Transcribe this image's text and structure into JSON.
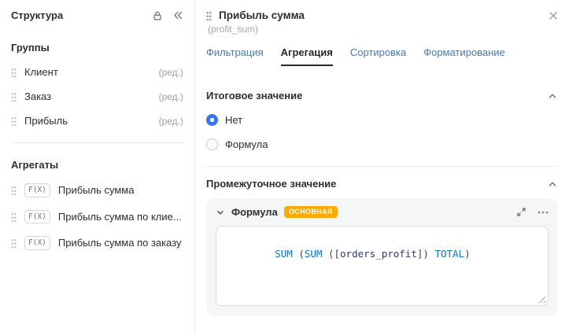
{
  "sidebar": {
    "title": "Структура",
    "groups_header": "Группы",
    "groups": [
      {
        "label": "Клиент",
        "edit": "(ред.)"
      },
      {
        "label": "Заказ",
        "edit": "(ред.)"
      },
      {
        "label": "Прибыль",
        "edit": "(ред.)"
      }
    ],
    "aggregates_header": "Агрегаты",
    "aggregates": [
      {
        "badge": "F(X)",
        "label": "Прибыль сумма"
      },
      {
        "badge": "F(X)",
        "label": "Прибыль сумма по клие..."
      },
      {
        "badge": "F(X)",
        "label": "Прибыль сумма по заказу"
      }
    ]
  },
  "panel": {
    "title": "Прибыль сумма",
    "subtitle": "(profit_sum)",
    "tabs": [
      {
        "label": "Фильтрация",
        "active": false
      },
      {
        "label": "Агрегация",
        "active": true
      },
      {
        "label": "Сортировка",
        "active": false
      },
      {
        "label": "Форматирование",
        "active": false
      }
    ],
    "total_section": {
      "title": "Итоговое значение",
      "options": [
        {
          "label": "Нет",
          "selected": true
        },
        {
          "label": "Формула",
          "selected": false
        }
      ]
    },
    "intermediate_section": {
      "title": "Промежуточное значение",
      "formula_card": {
        "title": "Формула",
        "badge": "ОСНОВНАЯ",
        "formula_text": "SUM (SUM ([orders_profit]) TOTAL)",
        "tokens": [
          {
            "text": "SUM",
            "type": "function"
          },
          {
            "text": " (",
            "type": "punct"
          },
          {
            "text": "SUM",
            "type": "function"
          },
          {
            "text": " ([",
            "type": "punct"
          },
          {
            "text": "orders_profit",
            "type": "field"
          },
          {
            "text": "])",
            "type": "punct"
          },
          {
            "text": " TOTAL",
            "type": "keyword"
          },
          {
            "text": ")",
            "type": "punct"
          }
        ]
      }
    }
  },
  "colors": {
    "accent_blue": "#3377f5",
    "tab_link_blue": "#4d78ac",
    "badge_orange": "#ffaa00",
    "code_function_blue": "#0b77d0",
    "code_field_navy": "#2f3a6e",
    "muted_gray": "#9aa0a6",
    "card_background": "#f4f6f7"
  },
  "icons": {
    "lock": "padlock-outline",
    "collapse": "double-chevron-left",
    "close": "x-cross",
    "section_chevron": "chevron-up",
    "card_chevron": "chevron-down",
    "expand": "diagonal-arrows-out",
    "more": "horizontal-ellipsis",
    "drag": "six-dots-handle",
    "resize": "diagonal-grip"
  }
}
